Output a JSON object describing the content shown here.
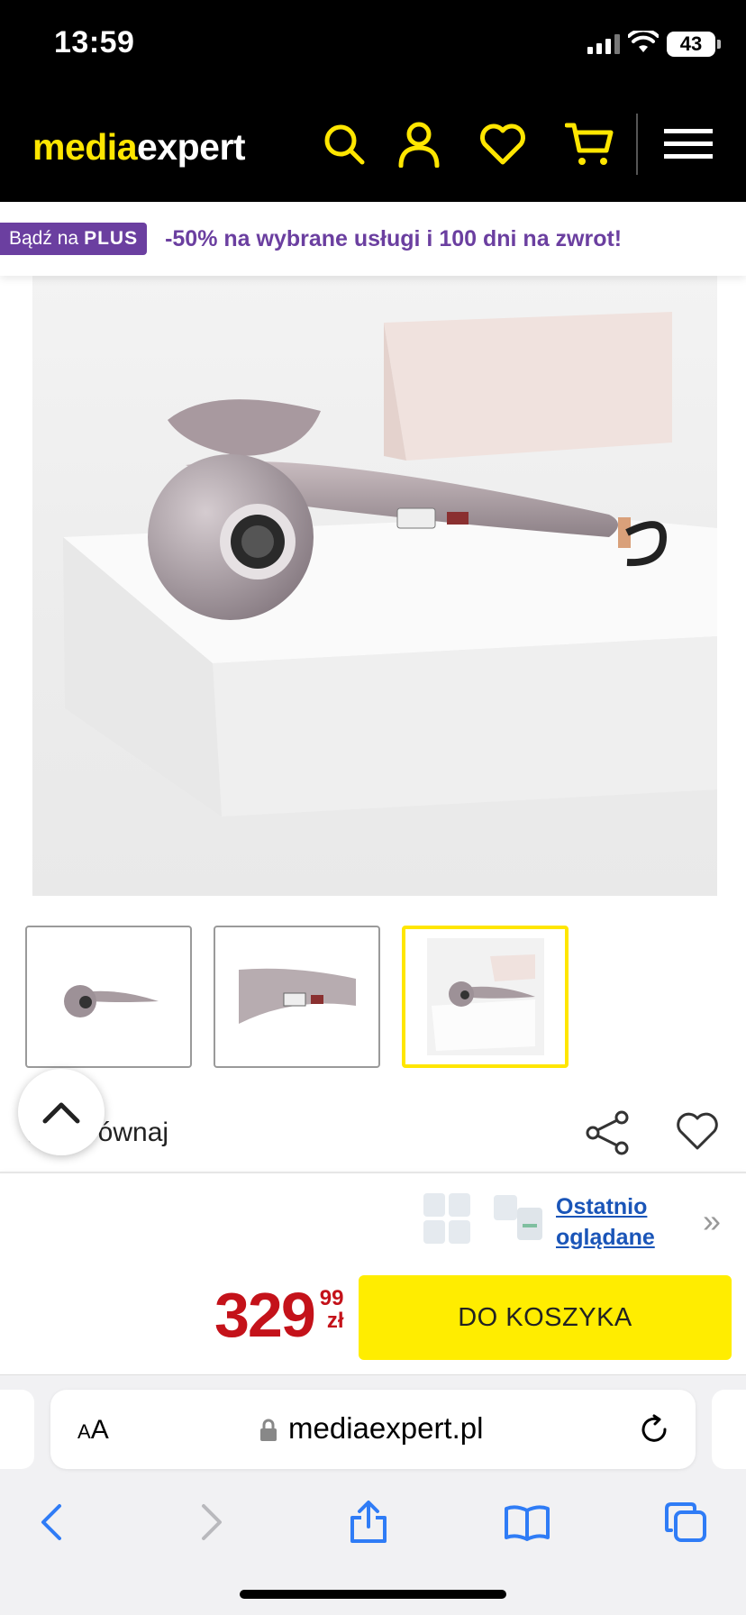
{
  "status_bar": {
    "time": "13:59",
    "battery": "43"
  },
  "header": {
    "logo_part1": "media",
    "logo_part2": "expert",
    "icons": [
      "search-icon",
      "account-icon",
      "wishlist-icon",
      "cart-icon",
      "menu-icon"
    ]
  },
  "promo": {
    "badge_text": "Bądź na",
    "badge_brand": "PLUS",
    "text": "-50% na wybrane usługi i 100 dni na zwrot!"
  },
  "gallery": {
    "thumbnail_count": 3,
    "active_index": 2
  },
  "compare": {
    "label": "Porównaj"
  },
  "recently_viewed": {
    "line1": "Ostatnio",
    "line2": "oglądane"
  },
  "buy": {
    "price_main": "329",
    "price_cents": "99",
    "currency": "zł",
    "button_label": "DO KOSZYKA"
  },
  "browser": {
    "aa": "AA",
    "url": "mediaexpert.pl"
  },
  "colors": {
    "brand_yellow": "#ffe600",
    "promo_purple": "#6b3fa0",
    "price_red": "#c4121a",
    "link_blue": "#1a55b8"
  }
}
